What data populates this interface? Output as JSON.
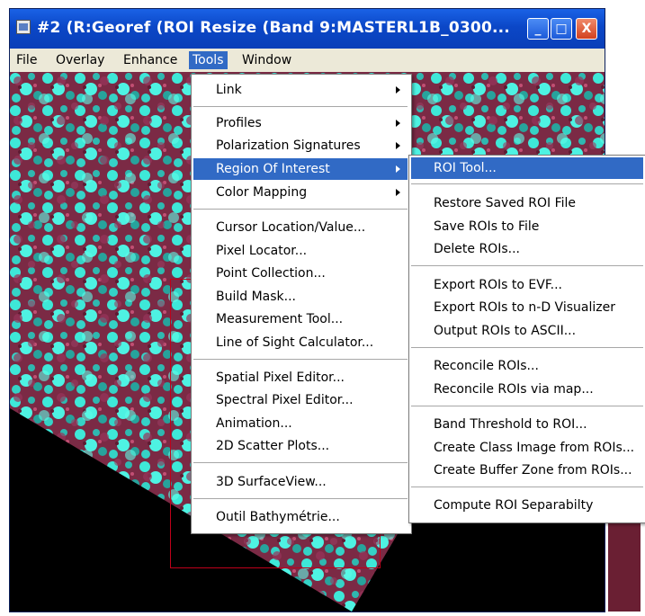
{
  "window": {
    "title": "#2 (R:Georef (ROI Resize (Band 9:MASTERL1B_0300...",
    "buttons": {
      "minimize": "_",
      "maximize": "□",
      "close": "X"
    }
  },
  "menubar": {
    "items": [
      "File",
      "Overlay",
      "Enhance",
      "Tools",
      "Window"
    ],
    "active": "Tools"
  },
  "tools_menu": {
    "items": [
      "Link",
      "Profiles",
      "Polarization Signatures",
      "Region Of Interest",
      "Color Mapping",
      "Cursor Location/Value...",
      "Pixel Locator...",
      "Point Collection...",
      "Build Mask...",
      "Measurement Tool...",
      "Line of Sight Calculator...",
      "Spatial Pixel Editor...",
      "Spectral Pixel Editor...",
      "Animation...",
      "2D Scatter Plots...",
      "3D SurfaceView...",
      "Outil Bathymétrie..."
    ],
    "highlighted": "Region Of Interest",
    "has_submenu": [
      "Link",
      "Profiles",
      "Polarization Signatures",
      "Region Of Interest",
      "Color Mapping"
    ]
  },
  "roi_submenu": {
    "items": [
      "ROI Tool...",
      "Restore Saved ROI File",
      "Save ROIs to File",
      "Delete ROIs...",
      "Export ROIs to EVF...",
      "Export ROIs to n-D Visualizer",
      "Output ROIs to ASCII...",
      "Reconcile ROIs...",
      "Reconcile ROIs via map...",
      "Band Threshold to ROI...",
      "Create Class Image from ROIs...",
      "Create Buffer Zone from ROIs...",
      "Compute ROI Separabilty"
    ],
    "highlighted": "ROI Tool..."
  },
  "colors": {
    "titlebar": "#0b47c7",
    "menu_highlight": "#316ac5",
    "menu_bg": "#ffffff",
    "menubar_bg": "#ece9d8",
    "roi_outline": "#c0001a",
    "image_cyan": "#3ee8d8",
    "image_red": "#8a2d45"
  }
}
